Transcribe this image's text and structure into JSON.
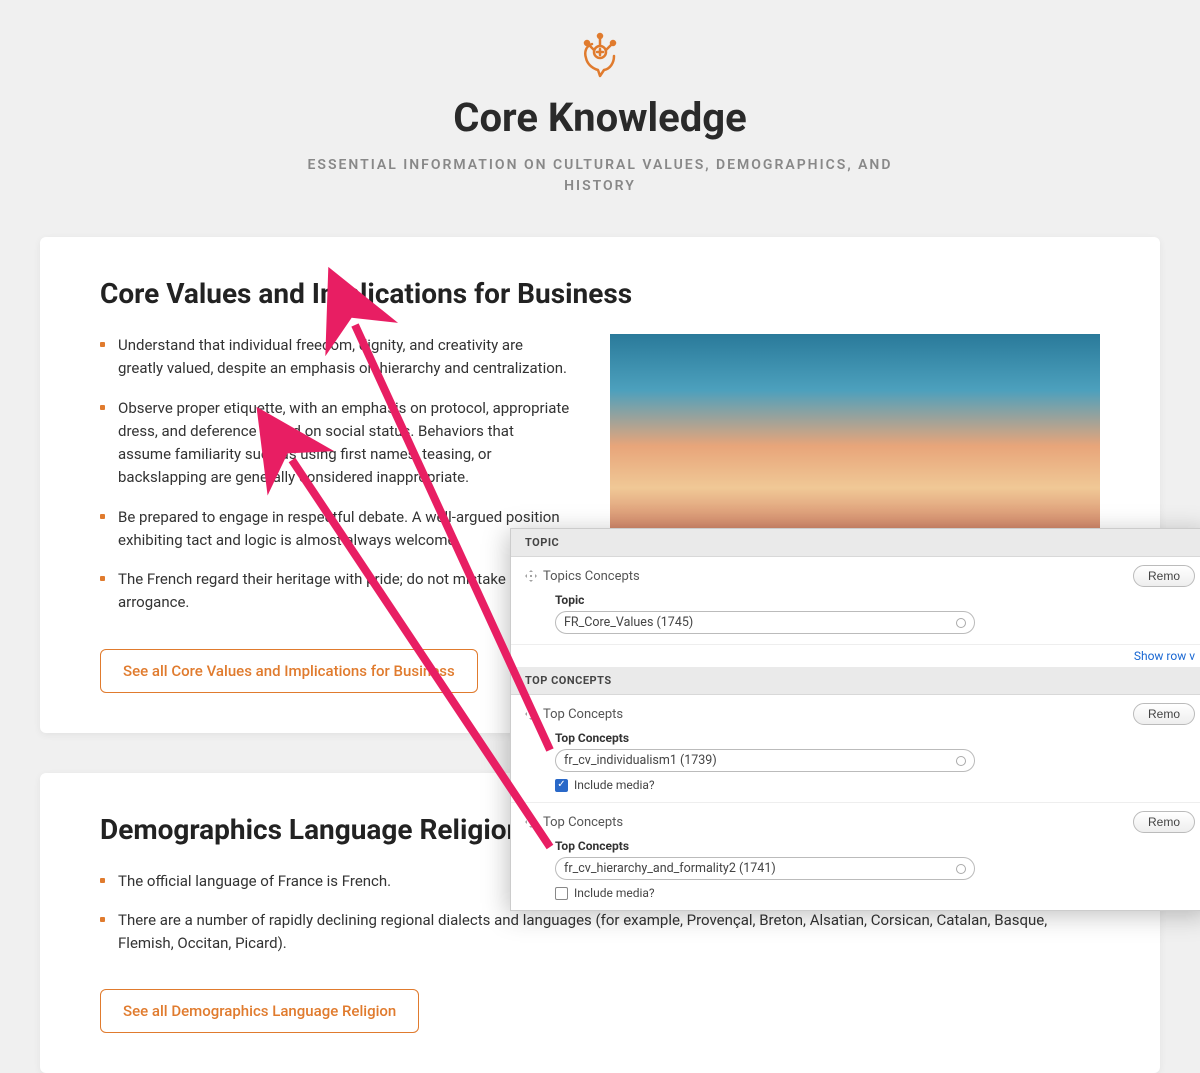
{
  "header": {
    "title": "Core Knowledge",
    "subtitle": "ESSENTIAL INFORMATION ON CULTURAL VALUES, DEMOGRAPHICS, AND HISTORY"
  },
  "cards": [
    {
      "title": "Core Values and Implications for Business",
      "bullets": [
        "Understand that individual freedom, dignity, and creativity are greatly valued, despite an emphasis on hierarchy and centralization.",
        "Observe proper etiquette, with an emphasis on protocol, appropriate dress, and deference based on social status. Behaviors that assume familiarity such as using first names, teasing, or backslapping are generally considered inappropriate.",
        "Be prepared to engage in respectful debate. A well-argued position exhibiting tact and logic is almost always welcome.",
        "The French regard their heritage with pride; do not mistake it for arrogance."
      ],
      "see_all": "See all Core Values and Implications for Business"
    },
    {
      "title": "Demographics Language Religion",
      "bullets": [
        "The official language of France is French.",
        "There are a number of rapidly declining regional dialects and languages (for example, Provençal, Breton, Alsatian, Corsican, Catalan, Basque, Flemish, Occitan, Picard)."
      ],
      "see_all": "See all Demographics Language Religion"
    }
  ],
  "panel": {
    "section1": "TOPIC",
    "section2": "TOP CONCEPTS",
    "topics_concepts": "Topics Concepts",
    "topic_label": "Topic",
    "topic_value": "FR_Core_Values (1745)",
    "show_row": "Show row v",
    "remove": "Remo",
    "tc_header": "Top Concepts",
    "tc1_label": "Top Concepts",
    "tc1_value": "fr_cv_individualism1 (1739)",
    "tc2_label": "Top Concepts",
    "tc2_value": "fr_cv_hierarchy_and_formality2 (1741)",
    "include_media": "Include media?"
  }
}
